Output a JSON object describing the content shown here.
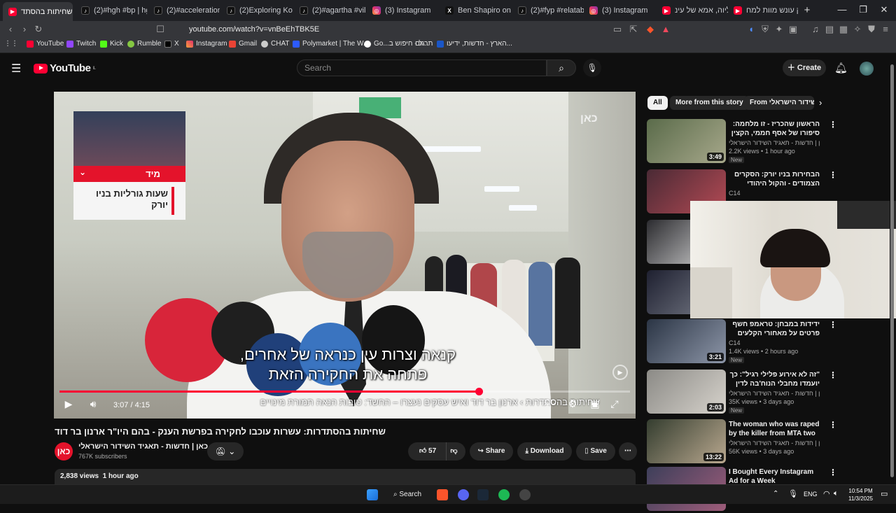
{
  "browser": {
    "tabs": [
      {
        "title": "שחיתות בהסתד",
        "icon": "youtube-icon",
        "active": true
      },
      {
        "title": "(2)#hgh #bp | hgh h",
        "icon": "tiktok-icon"
      },
      {
        "title": "(2)#accelerationism",
        "icon": "tiktok-icon"
      },
      {
        "title": "(2)Exploring Kosher",
        "icon": "tiktok-icon"
      },
      {
        "title": "(2)#agartha #villian",
        "icon": "tiktok-icon"
      },
      {
        "title": "(3) Instagram",
        "icon": "instagram-icon"
      },
      {
        "title": "Ben Shapiro on X: \"",
        "icon": "x-icon"
      },
      {
        "title": "(2)#fyp #relatable #",
        "icon": "tiktok-icon"
      },
      {
        "title": "(3) Instagram",
        "icon": "instagram-icon"
      },
      {
        "title": "עליוה, אמא של עינ",
        "icon": "youtube-icon"
      },
      {
        "title": "חוק עונש מוות למח",
        "icon": "youtube-icon"
      }
    ],
    "new_tab": "+",
    "url": "youtube.com/watch?v=vnBeEhTBK5E",
    "bookmarks": [
      "YouTube",
      "Twitch",
      "Kick",
      "Rumble",
      "X",
      "Instagram",
      "Gmail",
      "CHAT",
      "Polymarket | The W...",
      "Go...ל - חיפוש ב...",
      "תרגום",
      "הארץ - חדשות, ידיעו..."
    ]
  },
  "youtube": {
    "logo_text": "YouTube",
    "logo_region": "IL",
    "search_placeholder": "Search",
    "create_label": "Create",
    "video": {
      "inset_badge": "מיד",
      "inset_text": "שעות גורליות בניו יורק",
      "watermark": "כאן",
      "subtitle_line1": "קנאה וצרות עין כנראה של אחרים,",
      "subtitle_line2": "פתחה את החקירה הזאת",
      "ticker": "שחיתות בהסתדרות  ›  ארנון בר דוד ואיש עסקים נעצרו – החשד: טובות הנאה תמורת מינויים",
      "time_current": "3:07",
      "time_total": "4:15",
      "progress_fraction": 0.735
    },
    "title": "שחיתות בהסתדרות: עשרות עוכבו לחקירה בפרשת הענק - בהם היו\"ר ארנון בר דוד",
    "channel": {
      "name": "כאן | חדשות - תאגיד השידור הישראלי",
      "subscribers": "767K subscribers",
      "icon_text": "כאן"
    },
    "actions": {
      "likes": "57",
      "share": "Share",
      "download": "Download",
      "save": "Save"
    },
    "description": {
      "views": "2,838 views",
      "time": "1 hour ago"
    },
    "chips": [
      "All",
      "More from this story",
      "From השידור הישראלי"
    ],
    "recommendations": [
      {
        "title": "הראשון שהכריז - זו מלחמה: סיפורו של אסף חממי, הקצין הבכיר ביותר",
        "channel": "כאן | חדשות - תאגיד השידור הישראלי",
        "views": "2.2K views",
        "time": "1 hour ago",
        "badge": "New",
        "duration": "3:49"
      },
      {
        "title": "הבחירות בניו יורק: הסקרים הצמודים - והקול היהודי המפוצל | החדשות",
        "channel": "C14",
        "views": "",
        "time": "",
        "badge": "",
        "duration": ""
      },
      {
        "title": "",
        "channel": "",
        "views": "",
        "time": "",
        "badge": "",
        "duration": ""
      },
      {
        "title": "",
        "channel": "",
        "views": "",
        "time": "",
        "badge": "",
        "duration": ""
      },
      {
        "title": "ידידות במבחן: טראמפ חשף פרטים על מאחורי הקלעים של יחסיו עם",
        "channel": "C14",
        "views": "1.4K views",
        "time": "2 hours ago",
        "badge": "New",
        "duration": "3:21"
      },
      {
        "title": "\"זה לא אירוע פלילי רגיל\": כך יועמדו מחבלי הנוח'בה לדין",
        "channel": "כאן | חדשות - תאגיד השידור הישראלי",
        "views": "35K views",
        "time": "3 days ago",
        "badge": "New",
        "duration": "2:03"
      },
      {
        "title": "The woman who was raped by the killer from MTA two ...",
        "channel": "כאן | חדשות - תאגיד השידור הישראלי",
        "views": "56K views",
        "time": "3 days ago",
        "badge": "",
        "duration": "13:22"
      },
      {
        "title": "I Bought Every Instagram Ad for a Week",
        "channel": "",
        "views": "",
        "time": "",
        "badge": "",
        "duration": ""
      }
    ]
  },
  "taskbar": {
    "search_label": "Search",
    "language": "ENG",
    "time": "10:54 PM",
    "date": "11/3/2025"
  },
  "colors": {
    "youtube_red": "#ff0033",
    "kan_red": "#e4132b",
    "bg": "#0f0f0f"
  }
}
